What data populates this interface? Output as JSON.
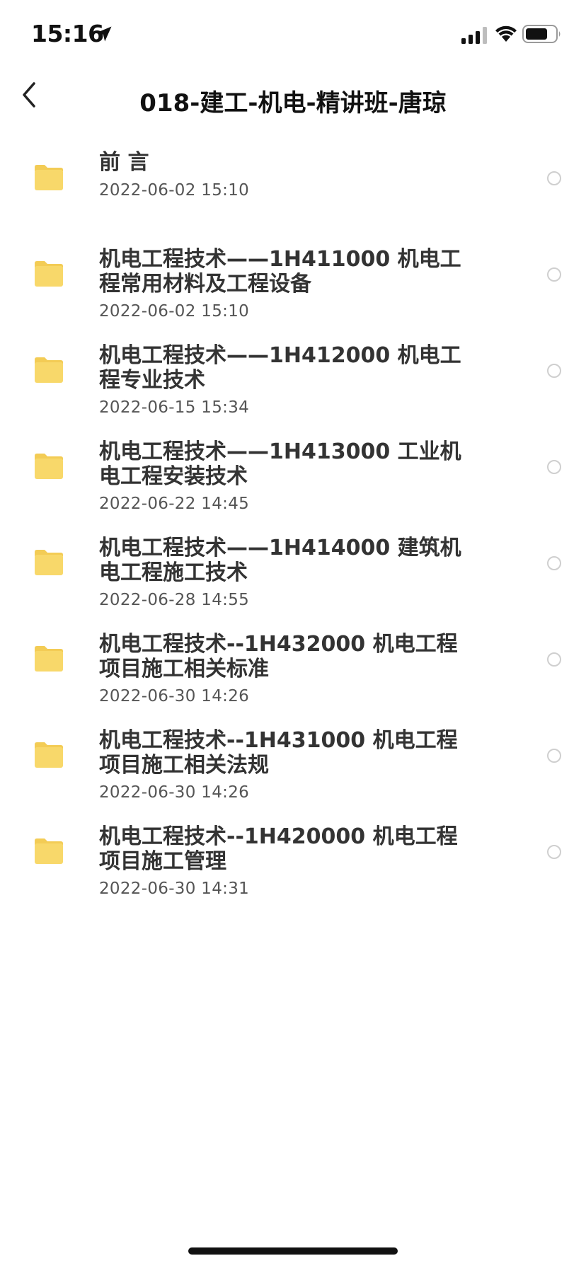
{
  "status_bar": {
    "time": "15:16",
    "location_icon": "location-arrow-icon",
    "signal_icon": "cellular-signal-icon",
    "wifi_icon": "wifi-icon",
    "battery_icon": "battery-icon"
  },
  "nav": {
    "back_icon": "chevron-left-icon",
    "title": "018-建工-机电-精讲班-唐琼"
  },
  "colors": {
    "folder": "#f8d86a",
    "folder_tab": "#f3cc55",
    "radio_border": "#cfcfcf"
  },
  "items": [
    {
      "name": "前 言",
      "date": "2022-06-02 15:10"
    },
    {
      "name": "机电工程技术——1H411000 机电工程常用材料及工程设备",
      "date": "2022-06-02 15:10"
    },
    {
      "name": "机电工程技术——1H412000 机电工程专业技术",
      "date": "2022-06-15 15:34"
    },
    {
      "name": "机电工程技术——1H413000 工业机电工程安装技术",
      "date": "2022-06-22 14:45"
    },
    {
      "name": "机电工程技术——1H414000 建筑机电工程施工技术",
      "date": "2022-06-28 14:55"
    },
    {
      "name": "机电工程技术--1H432000 机电工程项目施工相关标准",
      "date": "2022-06-30 14:26"
    },
    {
      "name": "机电工程技术--1H431000 机电工程项目施工相关法规",
      "date": "2022-06-30 14:26"
    },
    {
      "name": "机电工程技术--1H420000 机电工程项目施工管理",
      "date": "2022-06-30 14:31"
    }
  ]
}
